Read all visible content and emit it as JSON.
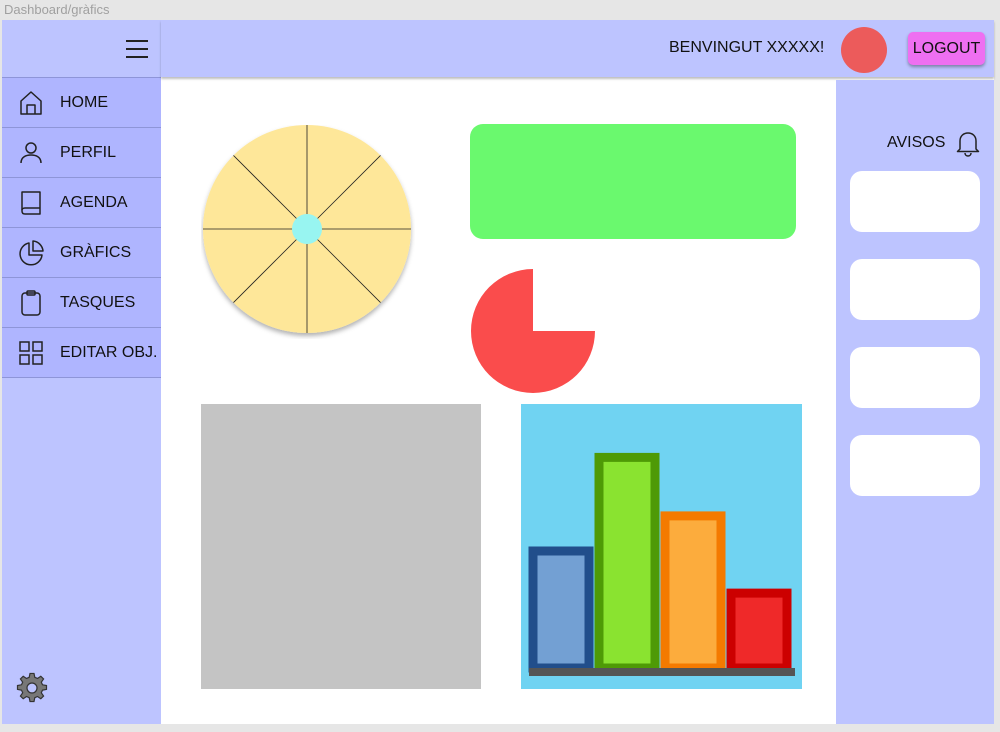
{
  "frame": {
    "title": "Dashboard/gràfics"
  },
  "header": {
    "welcome": "BENVINGUT XXXXX!",
    "logout_label": "LOGOUT",
    "avatar_color": "#ec5b5b"
  },
  "sidebar": {
    "items": [
      {
        "label": "HOME",
        "icon": "home-icon"
      },
      {
        "label": "PERFIL",
        "icon": "user-icon"
      },
      {
        "label": "AGENDA",
        "icon": "book-icon"
      },
      {
        "label": "GRÀFICS",
        "icon": "pie-chart-icon"
      },
      {
        "label": "TASQUES",
        "icon": "clipboard-icon"
      },
      {
        "label": "EDITAR OBJ.",
        "icon": "grid-icon"
      }
    ],
    "settings_icon": "gear-icon"
  },
  "notices": {
    "title": "AVISOS",
    "icon": "bell-icon",
    "count": 4
  },
  "colors": {
    "accent": "#bdc4ff",
    "nav_item": "#afb5ff",
    "logout": "#ee6ff1",
    "green_card": "#6af96e",
    "gray_placeholder": "#c4c4c4"
  },
  "chart_data": [
    {
      "type": "pie",
      "title": "",
      "slices": [
        12.5,
        12.5,
        12.5,
        12.5,
        12.5,
        12.5,
        12.5,
        12.5
      ],
      "colors": [
        "#fee799"
      ],
      "center_color": "#98f5f1"
    },
    {
      "type": "pie",
      "title": "",
      "slices": [
        {
          "value": 75,
          "color": "#fa4c4c"
        }
      ]
    },
    {
      "type": "bar",
      "title": "",
      "xlabel": "",
      "ylabel": "",
      "categories": [
        "",
        "",
        "",
        ""
      ],
      "values": [
        50,
        90,
        65,
        32
      ],
      "ylim": [
        0,
        100
      ],
      "colors": [
        {
          "fill": "#73a0d3",
          "border": "#214e8b"
        },
        {
          "fill": "#8ae330",
          "border": "#4e9a06"
        },
        {
          "fill": "#fcac3d",
          "border": "#f47a00"
        },
        {
          "fill": "#ef2929",
          "border": "#cc0000"
        }
      ],
      "background": "#70d3f2"
    }
  ]
}
